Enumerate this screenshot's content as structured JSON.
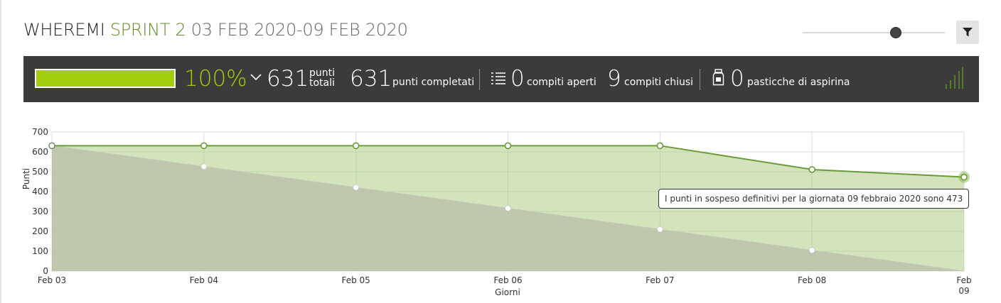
{
  "header": {
    "project": "WHEREMI",
    "sprint": "SPRINT 2",
    "dates": "03 FEB 2020-09 FEB 2020"
  },
  "zoom_slider": {
    "level": 0.65
  },
  "colors": {
    "accent_green": "#a2cd0c",
    "dark_green": "#5e8a26",
    "statbar_bg": "#3b3b3b"
  },
  "stats": {
    "progress_fraction": 1.0,
    "percent": "100%",
    "total_points": "631",
    "total_label_1": "punti",
    "total_label_2": "totali",
    "completed_points": "631",
    "completed_label": "punti completati",
    "open_tasks": "0",
    "open_label": "compiti aperti",
    "closed_tasks": "9",
    "closed_label": "compiti chiusi",
    "aspirin": "0",
    "aspirin_label": "pasticche di aspirina"
  },
  "icons": {
    "chevron": "chevron-down-icon",
    "filter": "filter-icon",
    "list": "list-icon",
    "bottle": "pill-bottle-icon",
    "signal": "signal-bars-icon"
  },
  "chart_data": {
    "type": "area",
    "xlabel": "Giorni",
    "ylabel": "Punti",
    "ylim": [
      0,
      700
    ],
    "yticks": [
      0,
      100,
      200,
      300,
      400,
      500,
      600,
      700
    ],
    "categories": [
      "Feb 03",
      "Feb 04",
      "Feb 05",
      "Feb 06",
      "Feb 07",
      "Feb 08",
      "Feb 09"
    ],
    "grid": true,
    "series": [
      {
        "name": "",
        "values": [
          631,
          631,
          631,
          631,
          631,
          511,
          473
        ]
      },
      {
        "name": "",
        "values": [
          631,
          526,
          421,
          316,
          210,
          105,
          0
        ]
      }
    ],
    "tooltip": "I punti in sospeso definitivi per la giornata 09 febbraio 2020 sono 473"
  }
}
